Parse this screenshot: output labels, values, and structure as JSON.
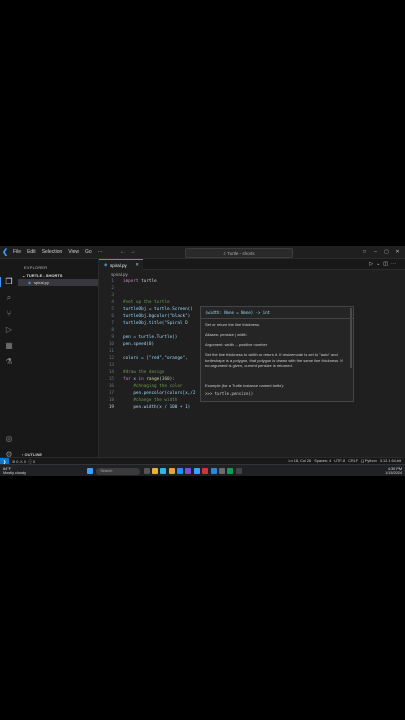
{
  "window": {
    "title": "Turtle - shorts",
    "menu": [
      "File",
      "Edit",
      "Selection",
      "View",
      "Go",
      "···"
    ]
  },
  "sidebar": {
    "title": "EXPLORER",
    "folder": "TURTLE - SHORTS",
    "file": "spiral.py",
    "outline": "OUTLINE",
    "timeline": "TIMELINE"
  },
  "editor": {
    "tab": "spiral.py",
    "breadcrumb": "spiral.py",
    "lines": [
      {
        "n": "1",
        "t": "import turtle"
      },
      {
        "n": "2",
        "t": ""
      },
      {
        "n": "3",
        "t": ""
      },
      {
        "n": "4",
        "t": "#set up the turtle"
      },
      {
        "n": "5",
        "t": "turtleObj = turtle.Screen()"
      },
      {
        "n": "6",
        "t": "turtleObj.bgcolor(\"black\")"
      },
      {
        "n": "7",
        "t": "turtleObj.title(\"Spiral D"
      },
      {
        "n": "8",
        "t": ""
      },
      {
        "n": "9",
        "t": "pen = turtle.Turtle()"
      },
      {
        "n": "10",
        "t": "pen.speed(0)"
      },
      {
        "n": "11",
        "t": ""
      },
      {
        "n": "12",
        "t": "colors = [\"red\",\"orange\","
      },
      {
        "n": "13",
        "t": ""
      },
      {
        "n": "14",
        "t": "#draw the design"
      },
      {
        "n": "15",
        "t": "for x in range(360):"
      },
      {
        "n": "16",
        "t": "    #chnaging the color"
      },
      {
        "n": "17",
        "t": "    pen.pencolor(colors[x,/2"
      },
      {
        "n": "18",
        "t": "    #change the width"
      },
      {
        "n": "19",
        "t": "    pen.width(x / 100 + 1)"
      }
    ]
  },
  "hover": {
    "signature": "(width: None = None) -> int",
    "p1": "Set or return the line thickness.",
    "p2": "Aliases: pensize | width",
    "p3": "Argument: width -- positive number",
    "p4": "Set the line thickness to width or return it. If resizemode is set to \"auto\" and turtleshape is a polygon, that polygon is drawn with the same line thickness. If no argument is given, current pensize is returned.",
    "p5": "Example (for a Turtle instance named turtle):",
    "p6": ">>> turtle.pensize()"
  },
  "status": {
    "problems": "⊘ 0 ⚠ 0",
    "ports": "ⓘ 0",
    "right": "Ln 18, Col 26   Spaces: 4   UTF-8   CRLF   {} Python   3.12.1 64-bit"
  },
  "taskbar": {
    "weather": "84°F",
    "weather_sub": "Mostly cloudy",
    "search": "Search",
    "time": "4:30 PM",
    "date": "1/15/2024"
  },
  "colors": {
    "accent": "#3794ff",
    "keyword": "#c586c0",
    "comment": "#6a9955",
    "string": "#ce9178"
  }
}
